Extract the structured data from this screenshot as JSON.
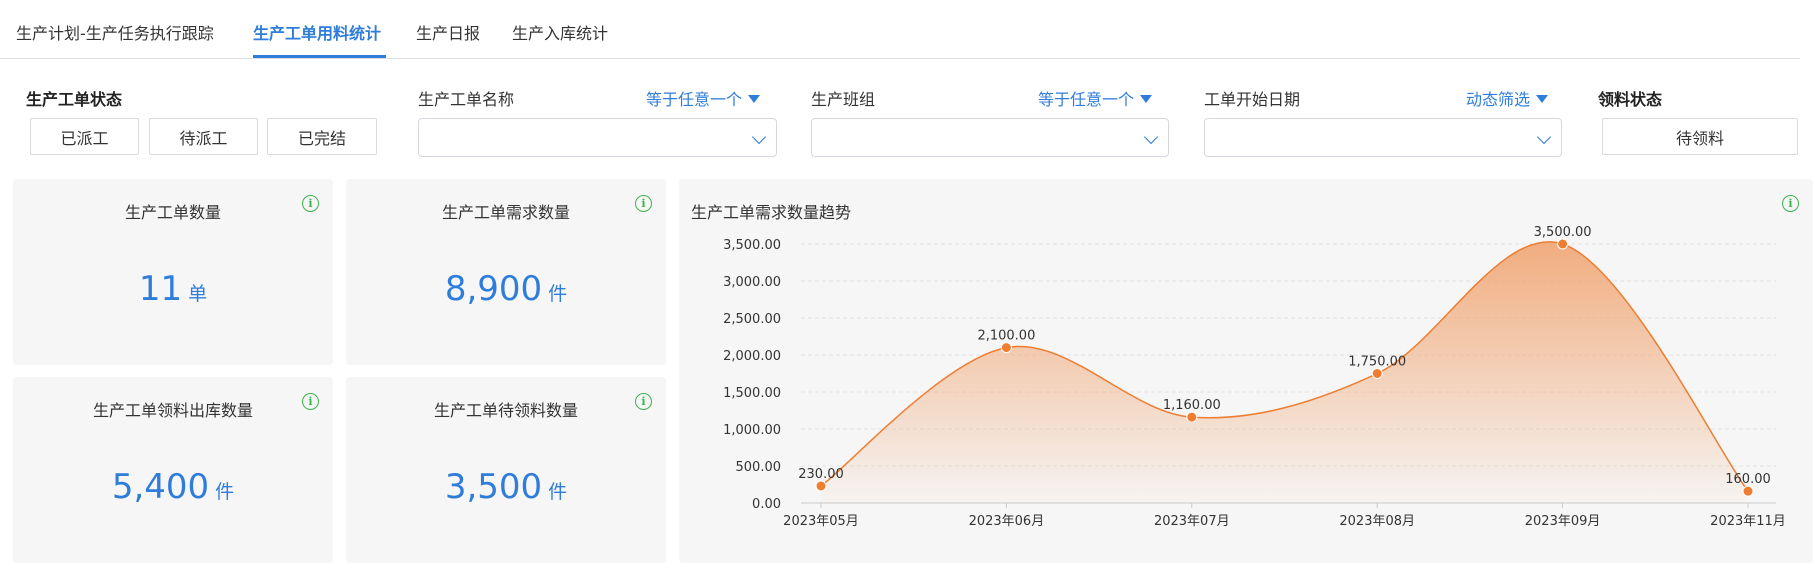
{
  "tabs": [
    {
      "label": "生产计划-生产任务执行跟踪",
      "active": false
    },
    {
      "label": "生产工单用料统计",
      "active": true
    },
    {
      "label": "生产日报",
      "active": false
    },
    {
      "label": "生产入库统计",
      "active": false
    }
  ],
  "filters": {
    "work_order_status": {
      "label": "生产工单状态",
      "buttons": [
        "已派工",
        "待派工",
        "已完结"
      ]
    },
    "work_order_name": {
      "label": "生产工单名称",
      "mode": "等于任意一个",
      "value": ""
    },
    "production_team": {
      "label": "生产班组",
      "mode": "等于任意一个",
      "value": ""
    },
    "start_date": {
      "label": "工单开始日期",
      "mode": "动态筛选",
      "value": ""
    },
    "material_status": {
      "label": "领料状态",
      "button": "待领料"
    }
  },
  "cards": [
    {
      "title": "生产工单数量",
      "value": "11",
      "unit": "单"
    },
    {
      "title": "生产工单需求数量",
      "value": "8,900",
      "unit": "件"
    },
    {
      "title": "生产工单领料出库数量",
      "value": "5,400",
      "unit": "件"
    },
    {
      "title": "生产工单待领料数量",
      "value": "3,500",
      "unit": "件"
    }
  ],
  "info_icon_glyph": "i",
  "colors": {
    "accent": "#2f7ddb",
    "info": "#3fb34f",
    "line": "#ee7d31",
    "area_top": "#f0a06a",
    "card_bg": "#f6f6f6"
  },
  "chart_data": {
    "type": "area",
    "title": "生产工单需求数量趋势",
    "categories": [
      "2023年05月",
      "2023年06月",
      "2023年07月",
      "2023年08月",
      "2023年09月",
      "2023年11月"
    ],
    "values": [
      230,
      2100,
      1160,
      1750,
      3500,
      160
    ],
    "value_labels": [
      "230.00",
      "2,100.00",
      "1,160.00",
      "1,750.00",
      "3,500.00",
      "160.00"
    ],
    "y_ticks": [
      "0.00",
      "500.00",
      "1,000.00",
      "1,500.00",
      "2,000.00",
      "2,500.00",
      "3,000.00",
      "3,500.00"
    ],
    "y_tick_values": [
      0,
      500,
      1000,
      1500,
      2000,
      2500,
      3000,
      3500
    ],
    "ylim": [
      0,
      3500
    ],
    "smooth": true,
    "grid": "horizontal dashed",
    "legend": "none"
  }
}
